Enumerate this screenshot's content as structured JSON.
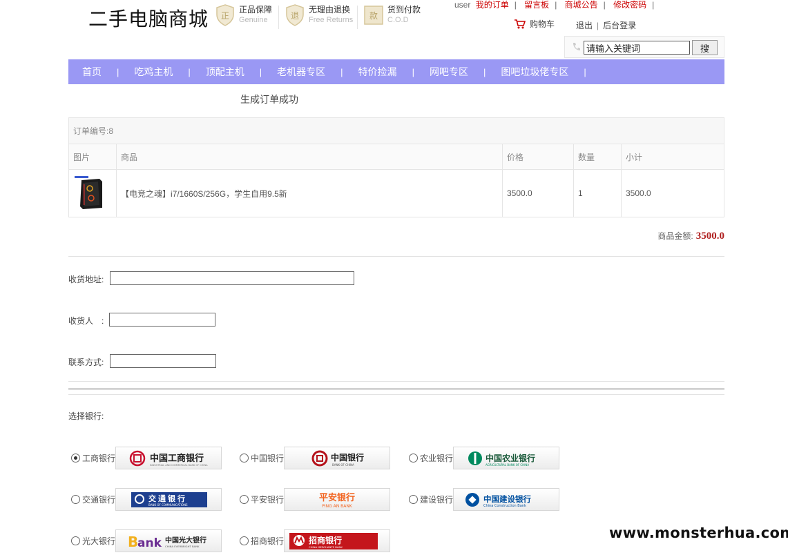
{
  "header": {
    "logo": "二手电脑商城",
    "badges": [
      {
        "main": "正品保障",
        "sub": "Genuine",
        "icon": "正"
      },
      {
        "main": "无理由退换",
        "sub": "Free Returns",
        "icon": "退"
      },
      {
        "main": "货到付款",
        "sub": "C.O.D",
        "icon": "款"
      }
    ],
    "user": "user",
    "links": [
      "我的订单",
      "留言板",
      "商城公告",
      "修改密码"
    ],
    "cart": "购物车",
    "logout": "退出",
    "admin_login": "后台登录",
    "search_value": "请输入关键词",
    "search_button": "搜"
  },
  "nav": [
    "首页",
    "吃鸡主机",
    "顶配主机",
    "老机器专区",
    "特价捡漏",
    "网吧专区",
    "图吧垃圾佬专区"
  ],
  "order": {
    "success": "生成订单成功",
    "order_no": "订单编号:8",
    "columns": [
      "图片",
      "商品",
      "价格",
      "数量",
      "小计"
    ],
    "item": {
      "name": "【电竞之魂】i7/1660S/256G，学生自用9.5新",
      "price": "3500.0",
      "qty": "1",
      "subtotal": "3500.0"
    },
    "total_label": "商品金额:",
    "total": "3500.0"
  },
  "form": {
    "address_label": "收货地址:",
    "receiver_label": "收货人　:",
    "phone_label": "联系方式:"
  },
  "banks": {
    "label": "选择银行:",
    "items": [
      {
        "name": "工商银行",
        "logo_text": "中国工商银行",
        "logo_sub": "INDUSTRIAL AND COMMERCIAL BANK OF CHINA",
        "color": "#c8102e"
      },
      {
        "name": "中国银行",
        "logo_text": "中国银行",
        "logo_sub": "BANK OF CHINA",
        "color": "#b5121b"
      },
      {
        "name": "农业银行",
        "logo_text": "中国农业银行",
        "logo_sub": "AGRICULTURAL BANK OF CHINA",
        "color": "#008a5e"
      },
      {
        "name": "交通银行",
        "logo_text": "交通银行",
        "logo_sub": "BANK OF COMMUNICATIONS",
        "color": "#1d3f8f"
      },
      {
        "name": "平安银行",
        "logo_text": "平安银行",
        "logo_sub": "PING AN BANK",
        "color": "#f26522"
      },
      {
        "name": "建设银行",
        "logo_text": "中国建设银行",
        "logo_sub": "China Construction Bank",
        "color": "#0050a0"
      },
      {
        "name": "光大银行",
        "logo_text": "中国光大银行",
        "logo_sub": "CHINA EVERBRIGHT BANK",
        "color": "#6a2c91"
      },
      {
        "name": "招商银行",
        "logo_text": "招商银行",
        "logo_sub": "CHINA MERCHANTS BANK",
        "color": "#c4161c"
      }
    ]
  },
  "watermark": "www.monsterhua.com"
}
